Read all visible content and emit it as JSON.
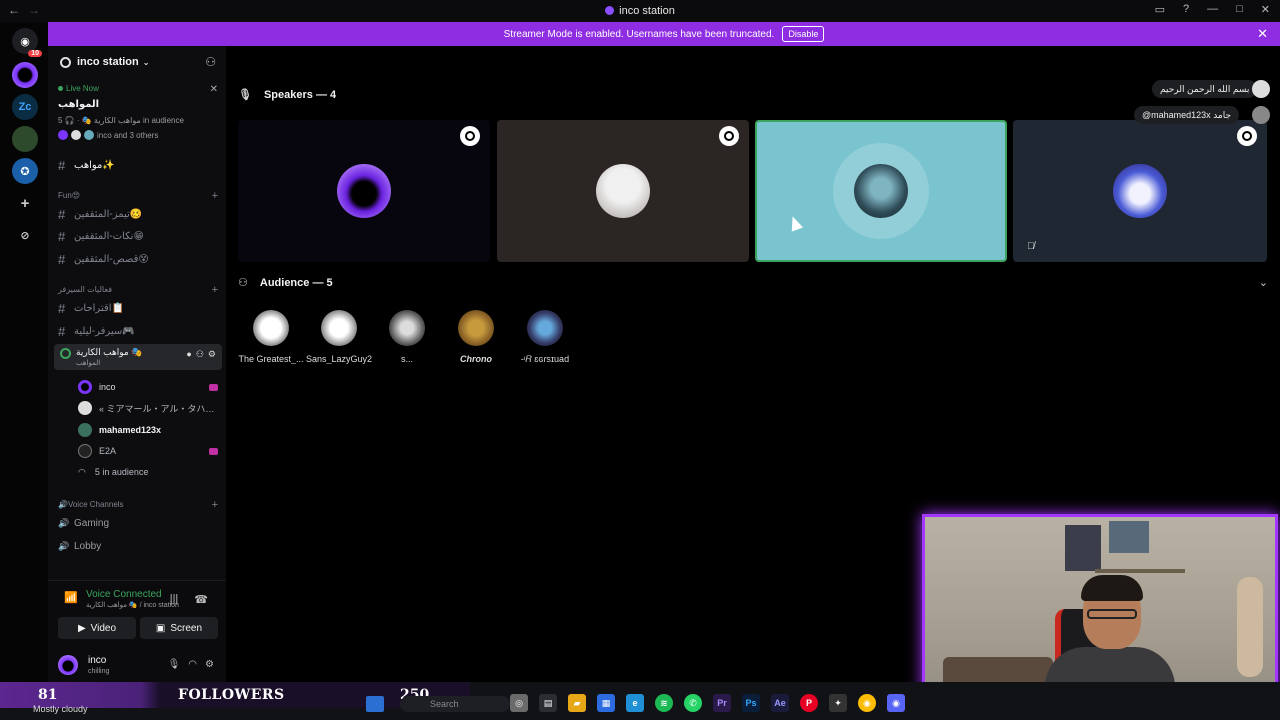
{
  "window": {
    "title": "inco station"
  },
  "banner": {
    "text": "Streamer Mode is enabled. Usernames have been truncated.",
    "button": "Disable"
  },
  "rail": {
    "badge": "10"
  },
  "server": {
    "name": "inco station"
  },
  "live": {
    "status": "Live Now",
    "stage_title": "المواهب",
    "sub": "مواهب الكارية 🎭 · 🎧 5 in audience",
    "others": "inco and 3 others"
  },
  "channels": {
    "top": "مواهب✨",
    "cat_fun": "Fun😍",
    "fun": [
      "تيمز-المثقفين🥴",
      "نكات-المثقفين😁",
      "قصص-المثقفين😵"
    ],
    "cat_srv": "فعاليات السيرفر",
    "srv": [
      "اقتراحات📋",
      "سيرفر-ليلية🎮"
    ],
    "stage_name": "مواهب الكارية 🎭",
    "stage_sub": "المواهب",
    "members": [
      "inco",
      "« ミアマール・アル・タハ…",
      "mahamed123x",
      "E2A"
    ],
    "audience_count": "5 in audience",
    "cat_voice": "🔊Voice Channels",
    "voice": [
      "Gaming",
      "Lobby"
    ]
  },
  "voice_panel": {
    "status": "Voice Connected",
    "sub": "مواهب الكارية 🎭 / inco station",
    "video": "Video",
    "screen": "Screen"
  },
  "user": {
    "name": "inco",
    "status": "chilling"
  },
  "stage": {
    "speakers_label": "Speakers — 4",
    "audience_label": "Audience — 5",
    "audience": [
      "The Greatest_...",
      "Sans_LazyGuy2",
      "s...",
      "Chrono",
      "-ᶦ𝑅 ɛɢɾsɪuad"
    ]
  },
  "tooltips": {
    "a": "بسم الله الرحمن الرحيم",
    "b": "@mahamed123x جامد"
  },
  "overlay": {
    "count1": "81",
    "label": "FOLLOWERS",
    "count2": "250"
  },
  "taskbar": {
    "weather": "Mostly cloudy",
    "search": "Search"
  },
  "colors": {
    "accent": "#8e2de2",
    "online": "#3ba55d",
    "speaking_tile": "#79c4cf",
    "cam_glow": "#a238ff"
  }
}
